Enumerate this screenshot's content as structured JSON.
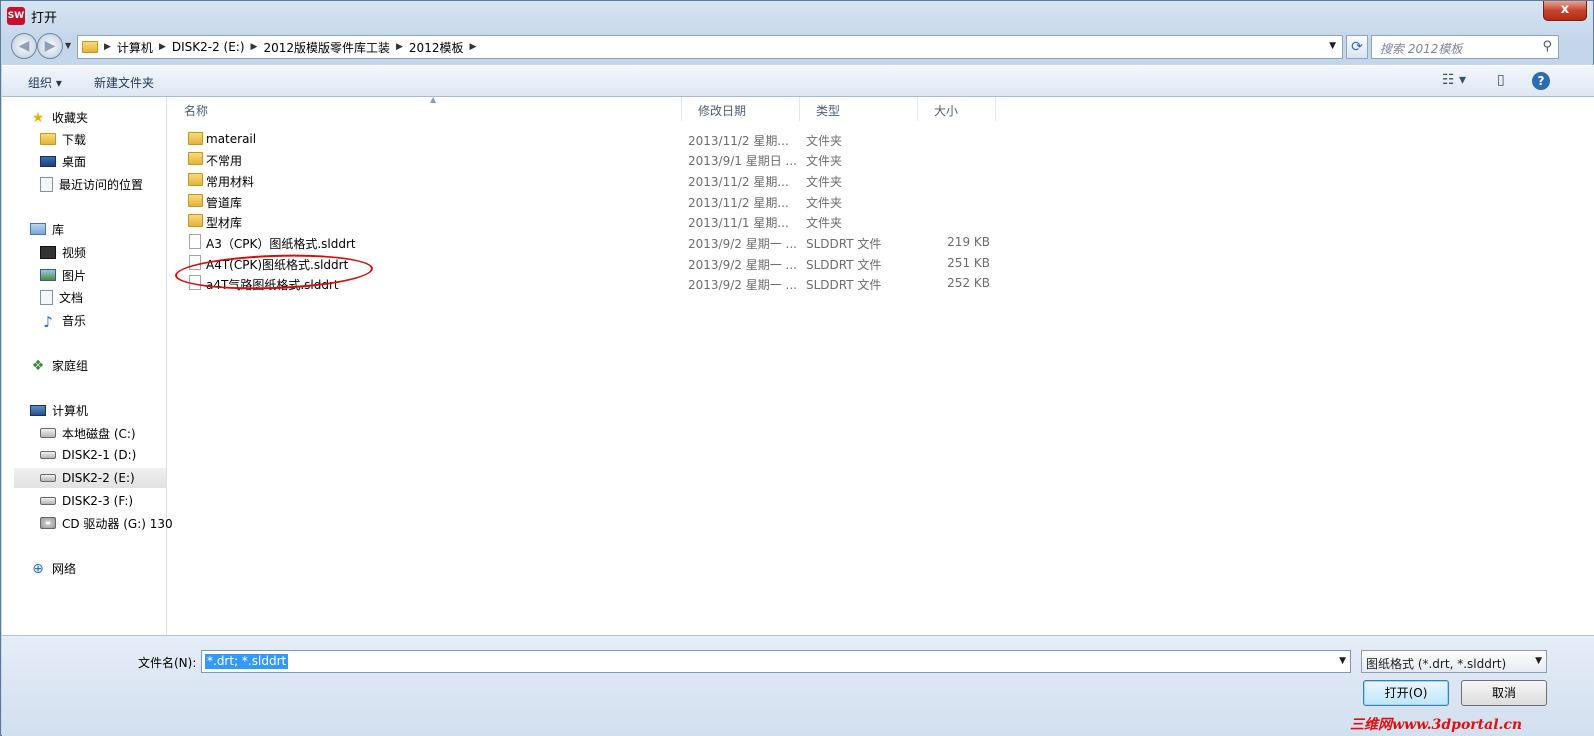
{
  "window": {
    "title": "打开",
    "app_icon": "SW",
    "close": "x"
  },
  "nav": {
    "back": "◀",
    "forward": "▶",
    "crumbs": [
      "计算机",
      "DISK2-2 (E:)",
      "2012版模版零件库工装",
      "2012模板"
    ],
    "search_placeholder": "搜索 2012模板"
  },
  "toolbar": {
    "organize": "组织 ▾",
    "new_folder": "新建文件夹"
  },
  "sidebar": {
    "favorites": "收藏夹",
    "downloads": "下载",
    "desktop": "桌面",
    "recent": "最近访问的位置",
    "libraries": "库",
    "videos": "视频",
    "pictures": "图片",
    "documents": "文档",
    "music": "音乐",
    "homegroup": "家庭组",
    "computer": "计算机",
    "drive_c": "本地磁盘 (C:)",
    "drive_d": "DISK2-1 (D:)",
    "drive_e": "DISK2-2 (E:)",
    "drive_f": "DISK2-3 (F:)",
    "drive_g": "CD 驱动器 (G:) 130",
    "network": "网络"
  },
  "columns": {
    "name": "名称",
    "date": "修改日期",
    "type": "类型",
    "size": "大小"
  },
  "files": [
    {
      "name": "materail",
      "date": "2013/11/2 星期...",
      "type": "文件夹",
      "size": "",
      "kind": "folder"
    },
    {
      "name": "不常用",
      "date": "2013/9/1 星期日 ...",
      "type": "文件夹",
      "size": "",
      "kind": "folder"
    },
    {
      "name": "常用材料",
      "date": "2013/11/2 星期...",
      "type": "文件夹",
      "size": "",
      "kind": "folder"
    },
    {
      "name": "管道库",
      "date": "2013/11/2 星期...",
      "type": "文件夹",
      "size": "",
      "kind": "folder"
    },
    {
      "name": "型材库",
      "date": "2013/11/1 星期...",
      "type": "文件夹",
      "size": "",
      "kind": "folder"
    },
    {
      "name": "A3（CPK）图纸格式.slddrt",
      "date": "2013/9/2 星期一 ...",
      "type": "SLDDRT 文件",
      "size": "219 KB",
      "kind": "file"
    },
    {
      "name": "A4T(CPK)图纸格式.slddrt",
      "date": "2013/9/2 星期一 ...",
      "type": "SLDDRT 文件",
      "size": "251 KB",
      "kind": "file"
    },
    {
      "name": "a4T气路图纸格式.slddrt",
      "date": "2013/9/2 星期一 ...",
      "type": "SLDDRT 文件",
      "size": "252 KB",
      "kind": "file"
    }
  ],
  "bottom": {
    "filename_label": "文件名(N):",
    "filename_value": "*.drt; *.slddrt",
    "filter_value": "图纸格式 (*.drt, *.slddrt)",
    "open": "打开(O)",
    "cancel": "取消"
  },
  "watermark": "三维网www.3dportal.cn",
  "colors": {
    "accent": "#3399ff",
    "highlight_ring": "#d01010"
  }
}
